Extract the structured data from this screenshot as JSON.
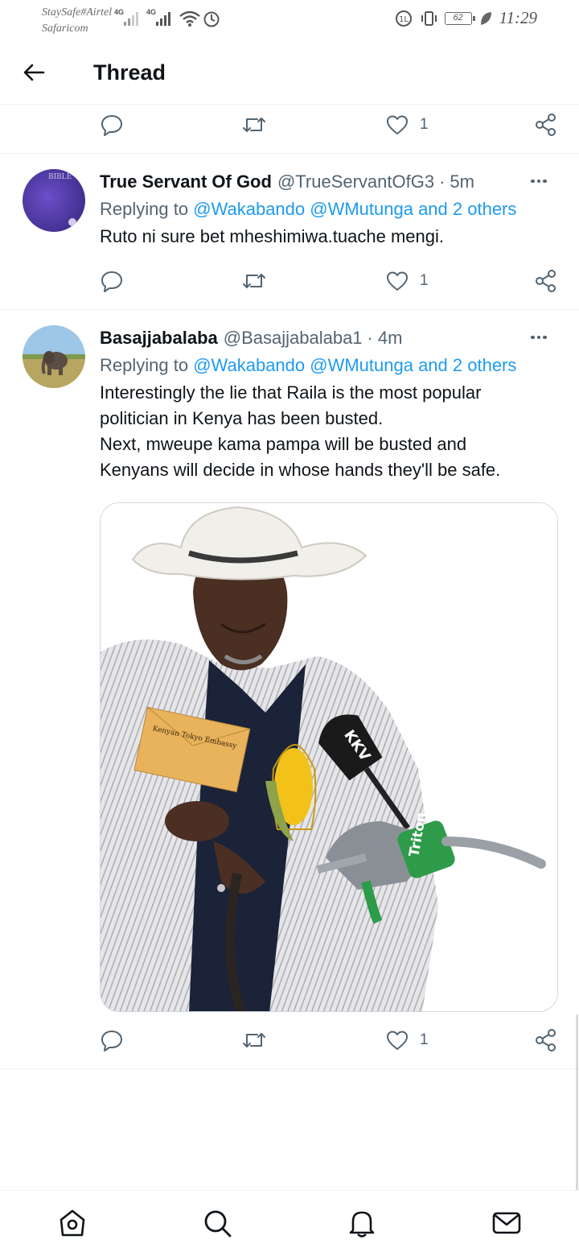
{
  "status_bar": {
    "carrier_1": "StaySafe#Airtel",
    "carrier_2": "Safaricom",
    "net_1": "4G",
    "net_2": "4G",
    "battery": "62",
    "time": "11:29"
  },
  "header": {
    "title": "Thread"
  },
  "top_actions": {
    "like_count": "1"
  },
  "tweets": [
    {
      "name": "True Servant Of God",
      "handle": "@TrueServantOfG3",
      "sep": "·",
      "time": "5m",
      "replying_prefix": "Replying to",
      "replying_to": "@Wakabando @WMutunga and 2 others",
      "text_lines": [
        "Ruto ni sure bet mheshimiwa.tuache mengi."
      ],
      "avatar_label": "BIBLE",
      "like_count": "1"
    },
    {
      "name": "Basajjabalaba",
      "handle": "@Basajjabalaba1",
      "sep": "·",
      "time": "4m",
      "replying_prefix": "Replying to",
      "replying_to": "@Wakabando @WMutunga and 2 others",
      "text_lines": [
        "Interestingly the lie that Raila is the most popular",
        "politician in Kenya has been busted.",
        "Next, mweupe kama pampa will be busted and",
        "Kenyans will decide in whose hands they'll be safe."
      ],
      "like_count": "1",
      "media": {
        "envelope_text": "Kenyan Tokyo Embassy",
        "shovel_text": "KKV",
        "nozzle_text": "Triton"
      }
    }
  ],
  "colors": {
    "accent": "#1d9bf0",
    "secondary_text": "#536471",
    "primary_text": "#0f1419",
    "divider": "#eff3f4"
  },
  "icons": {
    "back": "arrow-left-icon",
    "reply": "reply-icon",
    "retweet": "retweet-icon",
    "like": "heart-icon",
    "share": "share-icon",
    "more": "more-icon",
    "home": "home-icon",
    "search": "search-icon",
    "notifications": "bell-icon",
    "messages": "mail-icon"
  }
}
